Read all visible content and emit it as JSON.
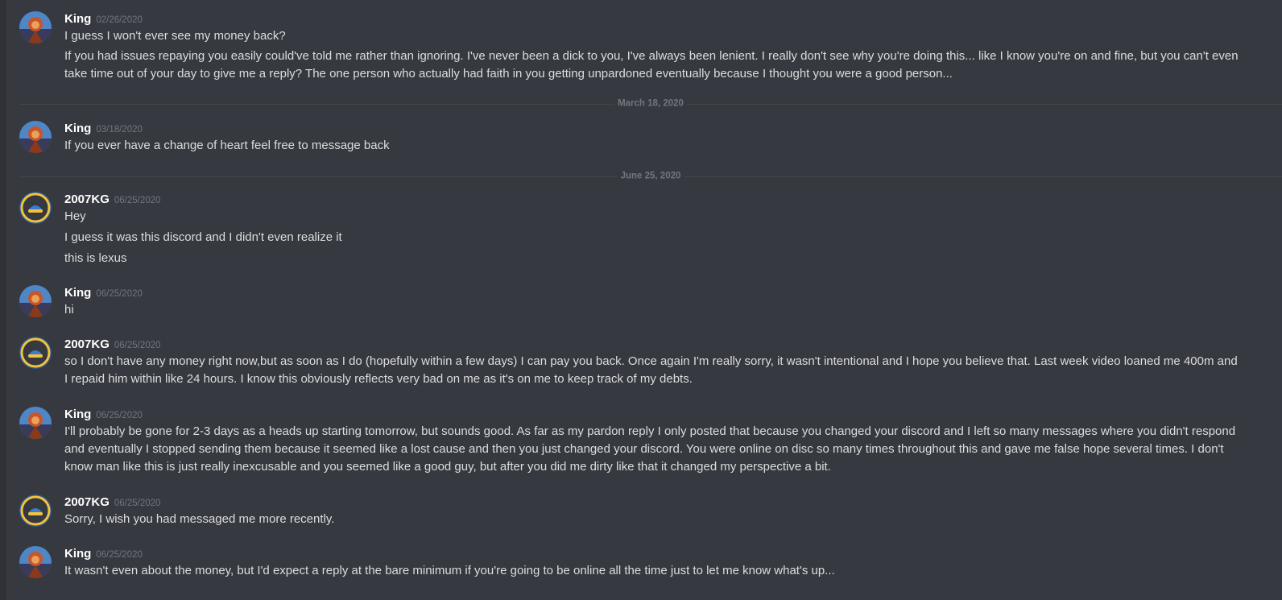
{
  "dividers": {
    "march": "March 18, 2020",
    "june": "June 25, 2020"
  },
  "messages": [
    {
      "author": "King",
      "timestamp": "02/26/2020",
      "lines": [
        "I guess I won't ever see my money back?",
        "If you had issues repaying you easily could've told me rather than ignoring. I've never been a dick to you, I've always been lenient. I really don't see why you're doing this... like I know you're on and fine, but you can't even take time out of your day to give me a reply? The one person who actually had faith in you getting unpardoned eventually because I thought you were a good person..."
      ]
    },
    {
      "author": "King",
      "timestamp": "03/18/2020",
      "lines": [
        "If you ever have a change of heart feel free to message back"
      ]
    },
    {
      "author": "2007KG",
      "timestamp": "06/25/2020",
      "lines": [
        "Hey",
        "I guess it was this discord and I didn't even realize it",
        "this is lexus"
      ]
    },
    {
      "author": "King",
      "timestamp": "06/25/2020",
      "lines": [
        "hi"
      ]
    },
    {
      "author": "2007KG",
      "timestamp": "06/25/2020",
      "lines": [
        "so I don't have any money right now,but as soon as I do (hopefully within a few days) I can pay you back. Once again I'm really sorry, it wasn't intentional and I hope you believe that. Last week video loaned me 400m and I repaid him within like 24 hours. I know this obviously reflects very bad on me as it's on me to keep track of my debts."
      ]
    },
    {
      "author": "King",
      "timestamp": "06/25/2020",
      "lines": [
        "I'll probably be gone for 2-3 days as a heads up starting tomorrow, but sounds good. As far as my pardon reply I only posted that because you changed your discord and I left so many messages where you didn't respond and eventually I stopped sending them because it seemed like a lost cause and then you just changed your discord. You were online on disc so many times throughout this and gave me false hope several times. I don't know man like this is just really inexcusable and you seemed like a good guy, but after you did me dirty like that it changed my perspective a bit."
      ]
    },
    {
      "author": "2007KG",
      "timestamp": "06/25/2020",
      "lines": [
        "Sorry, I wish you had messaged me more recently."
      ]
    },
    {
      "author": "King",
      "timestamp": "06/25/2020",
      "lines": [
        "It wasn't even about the money, but I'd expect a reply at the bare minimum if you're going to be online all the time just to let me know what's up..."
      ]
    }
  ],
  "colors": {
    "background": "#36393f",
    "username": "#ffffff",
    "message_text": "#dcddde",
    "timestamp": "#72767d",
    "divider": "#42454a"
  }
}
